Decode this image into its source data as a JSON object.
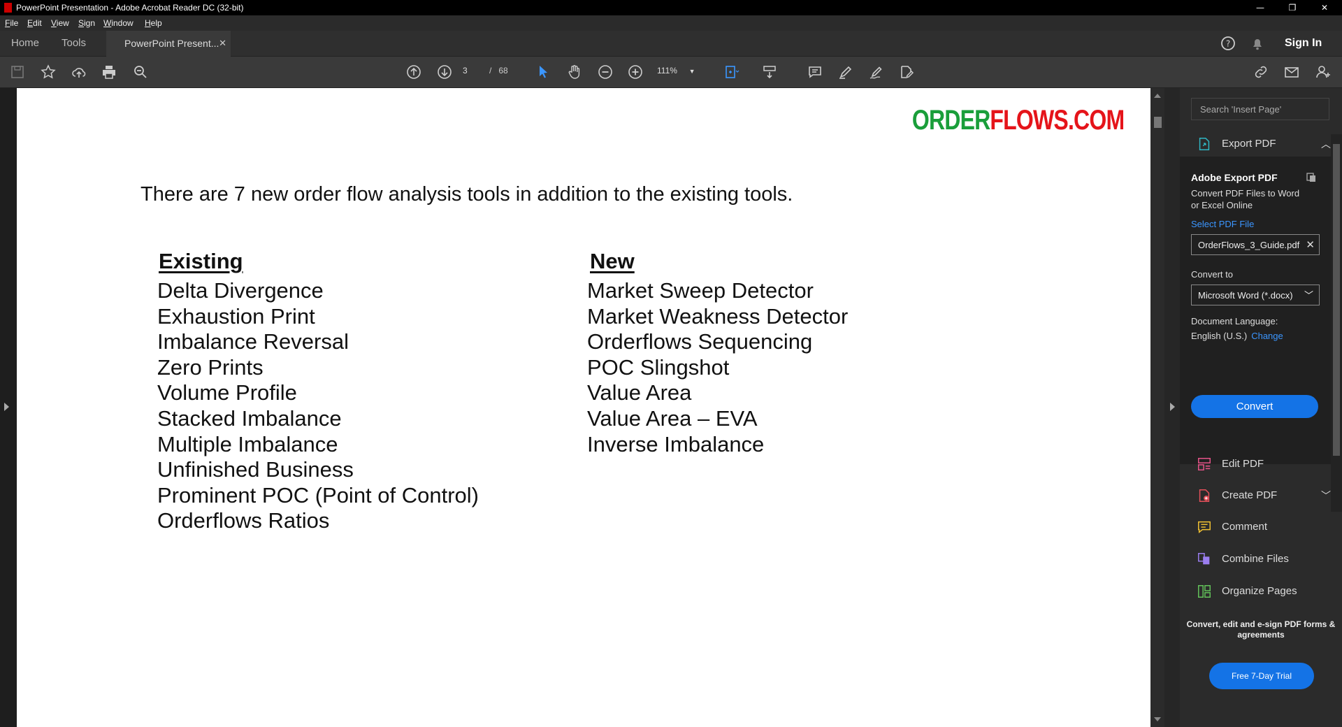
{
  "window": {
    "title": "PowerPoint Presentation - Adobe Acrobat Reader DC (32-bit)"
  },
  "menu": [
    "File",
    "Edit",
    "View",
    "Sign",
    "Window",
    "Help"
  ],
  "tabs": {
    "home": "Home",
    "tools": "Tools",
    "document": "PowerPoint Present...",
    "sign_in": "Sign In"
  },
  "toolbar": {
    "page_current": "3",
    "page_total": "68",
    "page_sep": "/",
    "zoom": "111%"
  },
  "document": {
    "logo_green": "ORDER",
    "logo_red": "FLOWS.COM",
    "intro": "There are 7 new order flow analysis tools in addition to the existing tools.",
    "existing_heading": "Existing",
    "existing_items": [
      "Delta Divergence",
      "Exhaustion Print",
      "Imbalance Reversal",
      "Zero Prints",
      "Volume Profile",
      "Stacked Imbalance",
      "Multiple Imbalance",
      "Unfinished Business",
      "Prominent POC (Point of Control)",
      "Orderflows Ratios"
    ],
    "new_heading": "New",
    "new_items": [
      "Market Sweep Detector",
      "Market Weakness Detector",
      "Orderflows Sequencing",
      "POC Slingshot",
      "Value Area",
      "Value Area – EVA",
      "Inverse Imbalance"
    ]
  },
  "panel": {
    "search_placeholder": "Search 'Insert Page'",
    "export_pdf": "Export PDF",
    "adobe_export_title": "Adobe Export PDF",
    "adobe_export_desc": "Convert PDF Files to Word or Excel Online",
    "select_file": "Select PDF File",
    "file_name": "OrderFlows_3_Guide.pdf",
    "convert_to_label": "Convert to",
    "convert_to_value": "Microsoft Word (*.docx)",
    "doc_language_label": "Document Language:",
    "doc_language_value": "English (U.S.)",
    "change": "Change",
    "convert_button": "Convert",
    "tools": [
      "Edit PDF",
      "Create PDF",
      "Comment",
      "Combine Files",
      "Organize Pages"
    ],
    "promo": "Convert, edit and e-sign PDF forms & agreements",
    "trial_button": "Free 7-Day Trial"
  },
  "colors": {
    "accent": "#1473e6",
    "logo_green": "#1a9e3a",
    "logo_red": "#e5141a"
  }
}
